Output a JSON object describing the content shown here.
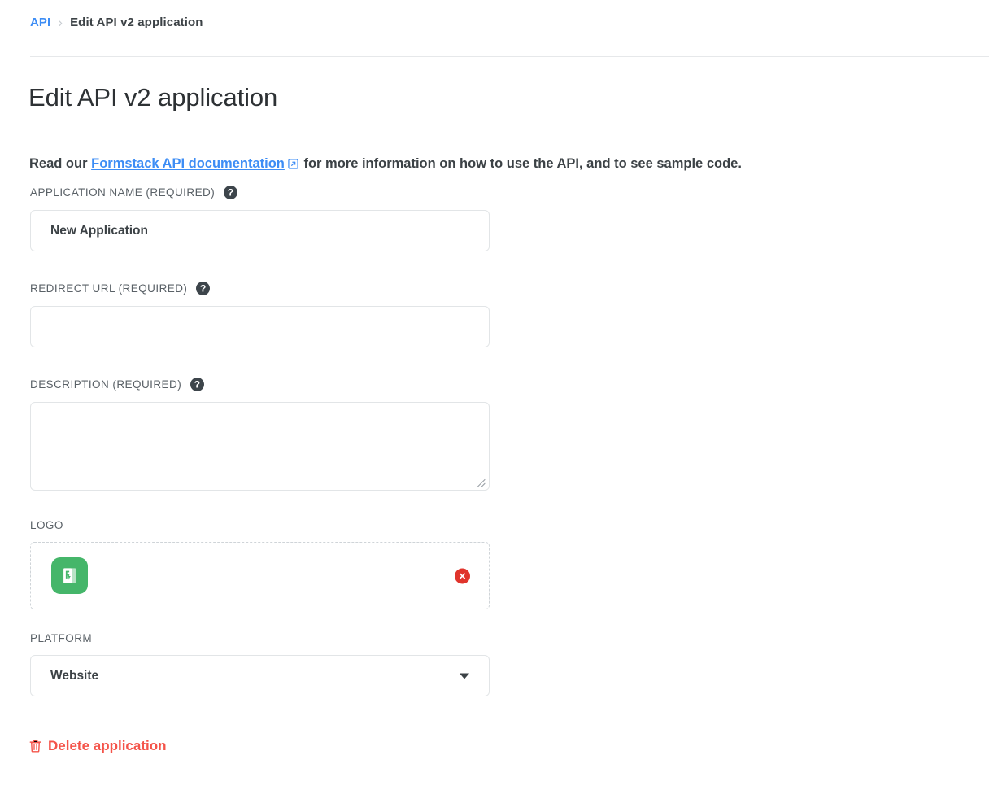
{
  "breadcrumb": {
    "parent_label": "API",
    "separator": "›",
    "current_label": "Edit API v2 application"
  },
  "page_title": "Edit API v2 application",
  "intro": {
    "prefix": "Read our ",
    "link_text": "Formstack API documentation",
    "suffix": " for more information on how to use the API, and to see sample code."
  },
  "help_glyph": "?",
  "form": {
    "application_name": {
      "label": "APPLICATION NAME (REQUIRED)",
      "value": "New Application",
      "placeholder": ""
    },
    "redirect_url": {
      "label": "REDIRECT URL (REQUIRED)",
      "value": "",
      "placeholder": ""
    },
    "description": {
      "label": "DESCRIPTION (REQUIRED)",
      "value": "",
      "placeholder": ""
    },
    "logo": {
      "label": "LOGO",
      "logo_alt": "Formstack logo",
      "remove_glyph": "✕"
    },
    "platform": {
      "label": "PLATFORM",
      "value": "Website",
      "options": [
        "Website"
      ]
    }
  },
  "delete_link": {
    "label": "Delete application"
  },
  "colors": {
    "link": "#3d8df5",
    "danger": "#f4544a",
    "remove_badge": "#e0342c",
    "logo_green": "#45b66a",
    "help_badge": "#3d454b",
    "text": "#3c4246",
    "border": "#e2e5e7"
  }
}
